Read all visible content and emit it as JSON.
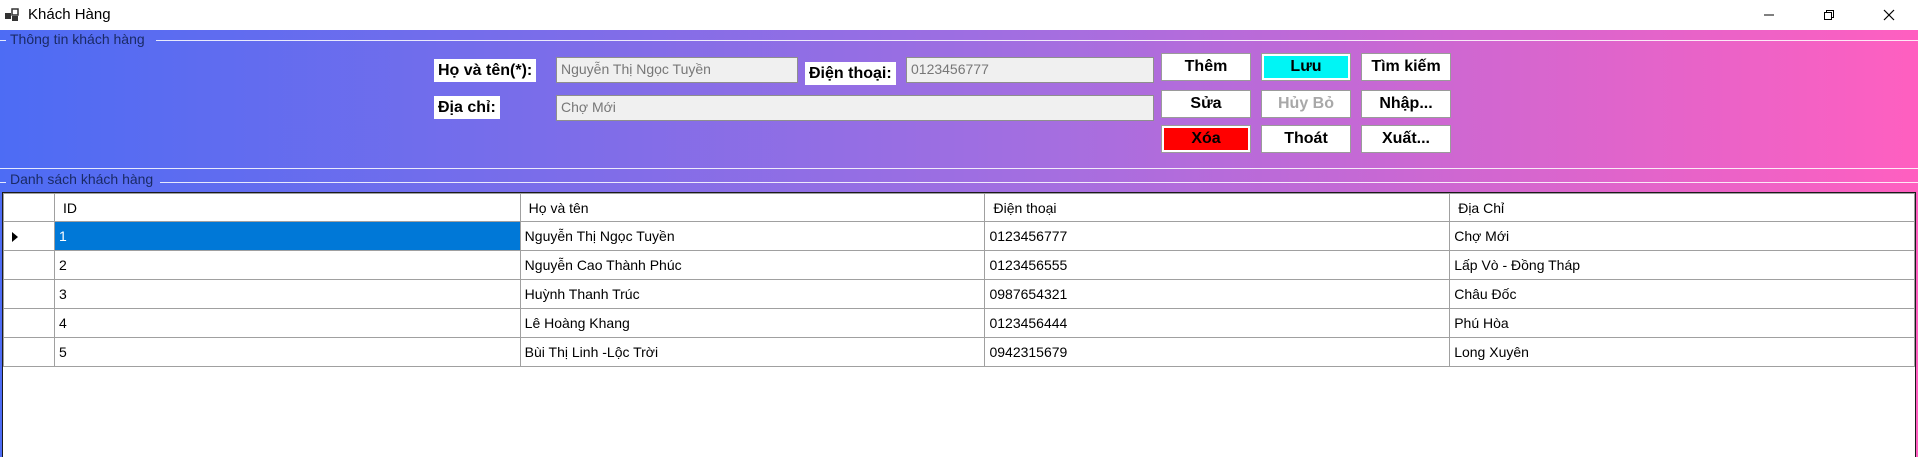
{
  "window": {
    "title": "Khách Hàng",
    "controls": [
      "minimize",
      "restore",
      "close"
    ]
  },
  "info_group": {
    "title": "Thông tin khách hàng",
    "name_label": "Họ và tên(*):",
    "name_value": "Nguyễn Thị Ngọc Tuyền",
    "phone_label": "Điện thoại:",
    "phone_value": "0123456777",
    "address_label": "Địa chỉ:",
    "address_value": "Chợ Mới"
  },
  "buttons": {
    "add": "Thêm",
    "save": "Lưu",
    "search": "Tìm kiếm",
    "edit": "Sửa",
    "cancel": "Hủy Bỏ",
    "import": "Nhập...",
    "delete": "Xóa",
    "exit": "Thoát",
    "export": "Xuất..."
  },
  "colors": {
    "save_button_bg": "#00f5f5",
    "delete_button_bg": "#ff0000",
    "selection": "#0078d7",
    "gradient_start": "#4d6cf4",
    "gradient_end": "#ff5fc0"
  },
  "list_group": {
    "title": "Danh sách khách hàng",
    "columns": [
      "ID",
      "Họ và tên",
      "Điện thoại",
      "Địa Chỉ"
    ],
    "rows": [
      {
        "id": "1",
        "name": "Nguyễn Thị Ngọc Tuyền",
        "phone": "0123456777",
        "address": "Chợ Mới"
      },
      {
        "id": "2",
        "name": "Nguyễn Cao Thành Phúc",
        "phone": "0123456555",
        "address": "Lấp Vò - Đồng Tháp"
      },
      {
        "id": "3",
        "name": "Huỳnh Thanh Trúc",
        "phone": "0987654321",
        "address": "Châu Đốc"
      },
      {
        "id": "4",
        "name": "Lê Hoàng Khang",
        "phone": "0123456444",
        "address": "Phú Hòa"
      },
      {
        "id": "5",
        "name": "Bùi Thị Linh -Lộc Trời",
        "phone": "0942315679",
        "address": "Long Xuyên"
      }
    ]
  }
}
